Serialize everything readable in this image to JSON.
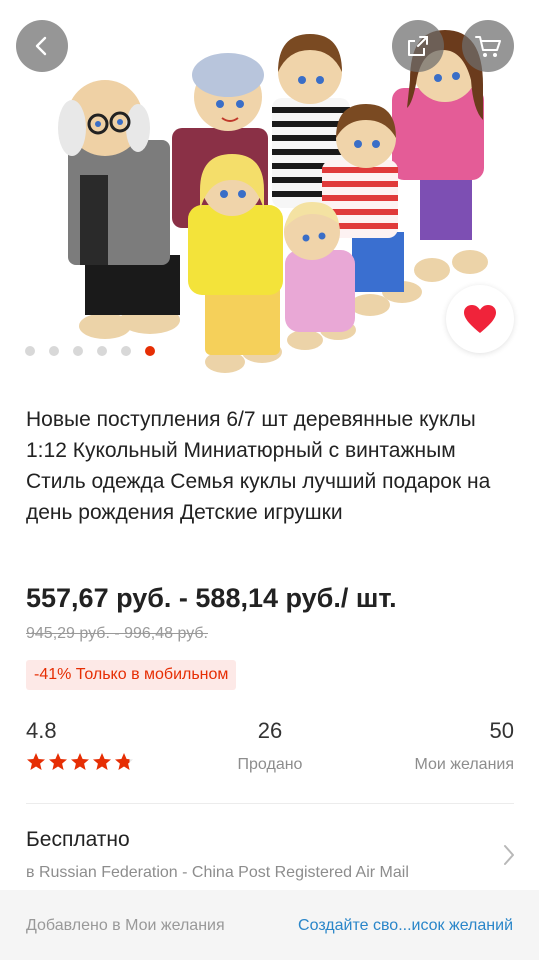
{
  "product": {
    "title": "Новые поступления 6/7 шт деревянные куклы 1:12 Кукольный Миниатюрный с винтажным Стиль одежда Семья куклы лучший подарок на день рождения Детские игрушки",
    "price": "557,67 руб. - 588,14 руб./ шт.",
    "old_price": "945,29 руб. - 996,48 руб.",
    "discount_badge": "-41% Только в мобильном"
  },
  "gallery": {
    "total_images": 6,
    "active_index": 5
  },
  "stats": {
    "rating": "4.8",
    "rating_stars": 4.8,
    "sold_count": "26",
    "sold_label": "Продано",
    "wishlist_count": "50",
    "wishlist_label": "Мои желания"
  },
  "shipping": {
    "title": "Бесплатно",
    "detail": "в Russian Federation - China Post Registered Air Mail"
  },
  "footer": {
    "added_text": "Добавлено в Мои желания",
    "create_link": "Создайте сво...исок желаний"
  },
  "icons": {
    "back": "back-arrow-icon",
    "share": "share-icon",
    "cart": "cart-icon",
    "favorite": "heart-icon",
    "chevron": "chevron-right-icon"
  },
  "colors": {
    "accent": "#e62e04",
    "link": "#2a86c9",
    "heart": "#f0233a"
  }
}
